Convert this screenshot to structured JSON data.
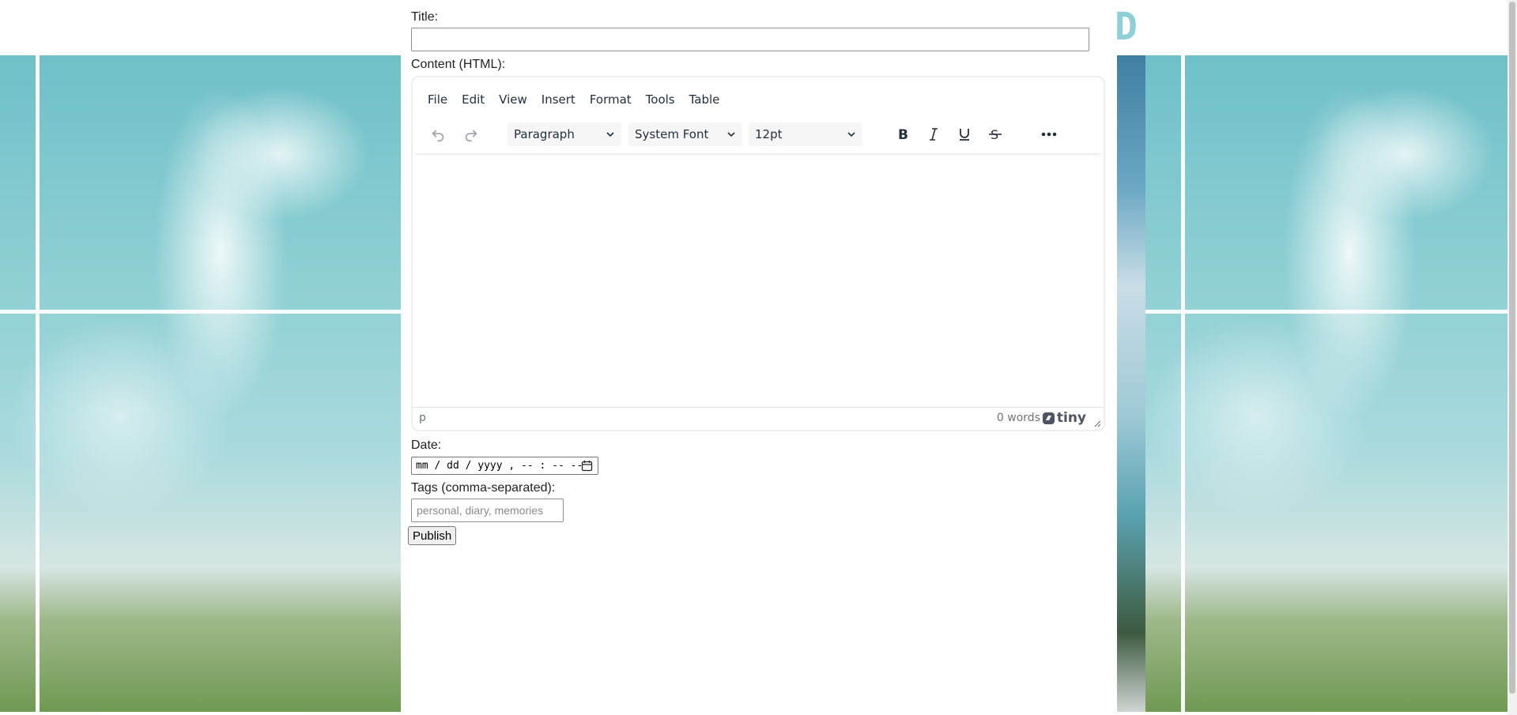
{
  "background": {
    "logo_glyph": "D",
    "accent": "#8fd0d6"
  },
  "form": {
    "title_label": "Title:",
    "title_value": "",
    "content_label": "Content (HTML):",
    "date_label": "Date:",
    "date_placeholder": "mm / dd / yyyy ,  -- : --  --",
    "tags_label": "Tags (comma-separated):",
    "tags_placeholder": "personal, diary, memories",
    "publish_label": "Publish"
  },
  "editor": {
    "menus": [
      "File",
      "Edit",
      "View",
      "Insert",
      "Format",
      "Tools",
      "Table"
    ],
    "toolbar": {
      "undo_icon": "undo-icon",
      "redo_icon": "redo-icon",
      "block_format": "Paragraph",
      "font_family": "System Font",
      "font_size": "12pt",
      "bold_icon": "bold-icon",
      "italic_icon": "italic-icon",
      "underline_icon": "underline-icon",
      "strikethrough_icon": "strikethrough-icon",
      "more_icon": "more-icon"
    },
    "status": {
      "path": "p",
      "word_count": "0 words",
      "brand": "tiny"
    }
  }
}
